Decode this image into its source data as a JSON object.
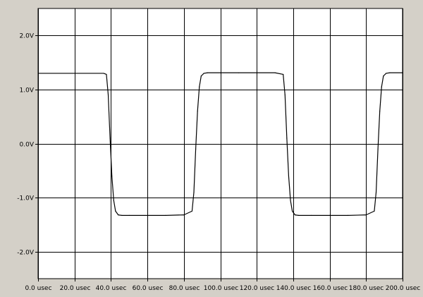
{
  "chart_data": {
    "type": "line",
    "title": "",
    "xlabel": "",
    "ylabel": "",
    "xlim": [
      0,
      200
    ],
    "ylim": [
      -2.5,
      2.5
    ],
    "x_ticks": [
      0,
      20,
      40,
      60,
      80,
      100,
      120,
      140,
      160,
      180,
      200
    ],
    "x_tick_labels": [
      "0.0 usec",
      "20.0 usec",
      "40.0 usec",
      "60.0 usec",
      "80.0 usec",
      "100.0 usec",
      "120.0 usec",
      "140.0 usec",
      "160.0 usec",
      "180.0 usec",
      "200.0 usec"
    ],
    "y_ticks": [
      2,
      1,
      0,
      -1,
      -2
    ],
    "y_tick_labels": [
      "2.0V",
      "1.0V",
      "0.0V",
      "-1.0V",
      "-2.0V"
    ],
    "grid": true,
    "colors": {
      "frame_bg": "#d4d0c8",
      "plot_bg": "#ffffff",
      "grid": "#000000",
      "trace": "#000000"
    },
    "series": [
      {
        "x": [
          0,
          36,
          37.5,
          38.5,
          39.5,
          40.5,
          41.5,
          42.5,
          44,
          46,
          50,
          60,
          70,
          80,
          84.5,
          85.5,
          86.5,
          87.5,
          88.5,
          89.5,
          91,
          93,
          100,
          110,
          120,
          130,
          134.5,
          135.5,
          136.5,
          137.5,
          138.5,
          139.5,
          141,
          143,
          150,
          160,
          170,
          180,
          184.5,
          185.5,
          186.5,
          187.5,
          188.5,
          189.5,
          191,
          193,
          200
        ],
        "y": [
          1.3,
          1.3,
          1.28,
          0.9,
          0.1,
          -0.6,
          -1.05,
          -1.25,
          -1.32,
          -1.33,
          -1.33,
          -1.33,
          -1.33,
          -1.32,
          -1.25,
          -0.9,
          -0.1,
          0.6,
          1.05,
          1.25,
          1.3,
          1.31,
          1.31,
          1.31,
          1.31,
          1.31,
          1.28,
          0.9,
          0.1,
          -0.6,
          -1.05,
          -1.25,
          -1.32,
          -1.33,
          -1.33,
          -1.33,
          -1.33,
          -1.32,
          -1.25,
          -0.9,
          -0.1,
          0.6,
          1.05,
          1.25,
          1.3,
          1.31,
          1.31
        ]
      }
    ]
  }
}
